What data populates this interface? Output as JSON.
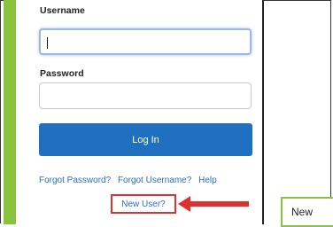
{
  "login": {
    "username_label": "Username",
    "username_value": "",
    "password_label": "Password",
    "password_value": "",
    "login_button": "Log In",
    "links": {
      "forgot_password": "Forgot Password?",
      "forgot_username": "Forgot Username?",
      "help": "Help",
      "new_user": "New User?"
    }
  },
  "popup": {
    "text": "New"
  },
  "colors": {
    "green_bar": "#8ac43f",
    "button": "#1f70c1",
    "link": "#2a6bd0",
    "highlight": "#e03131"
  }
}
